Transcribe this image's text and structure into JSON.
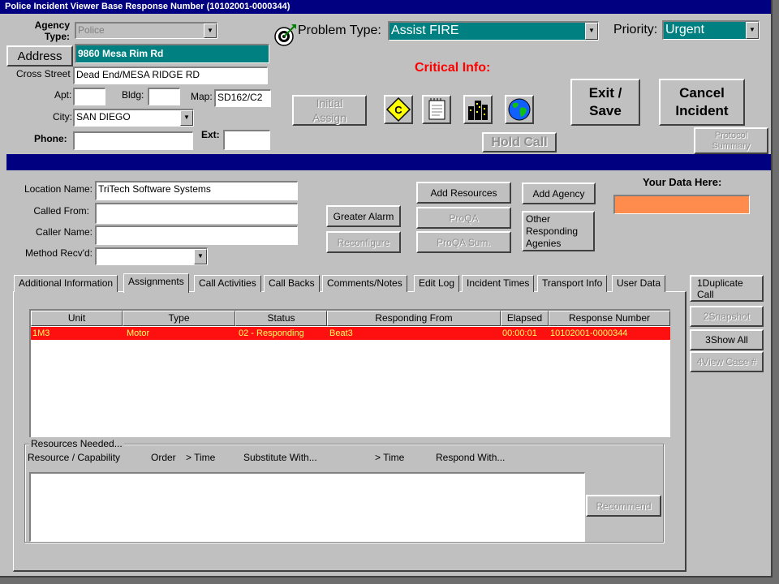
{
  "window": {
    "title": "Police Incident Viewer Base Response Number (10102001-0000344)"
  },
  "header": {
    "agency_type_label": "Agency Type:",
    "agency_type_value": "Police",
    "address_button": "Address",
    "address_value": "9860 Mesa Rim Rd",
    "cross_street_label": "Cross Street",
    "cross_street_value": "Dead End/MESA RIDGE RD",
    "apt_label": "Apt:",
    "apt_value": "",
    "bldg_label": "Bldg:",
    "bldg_value": "",
    "map_label": "Map:",
    "map_value": "SD162/C2",
    "city_label": "City:",
    "city_value": "SAN DIEGO",
    "phone_label": "Phone:",
    "phone_value": "",
    "ext_label": "Ext:",
    "ext_value": "",
    "problem_type_label": "Problem Type:",
    "problem_type_value": "Assist FIRE",
    "priority_label": "Priority:",
    "priority_value": "Urgent",
    "critical_info_label": "Critical Info:",
    "initial_assign_line1": "Initial",
    "initial_assign_line2": "Assign",
    "exit_save_line1": "Exit /",
    "exit_save_line2": "Save",
    "cancel_incident_line1": "Cancel",
    "cancel_incident_line2": "Incident",
    "hold_call": "Hold Call",
    "protocol_summary_line1": "Protocol",
    "protocol_summary_line2": "Summary"
  },
  "details": {
    "location_name_label": "Location Name:",
    "location_name_value": "TriTech Software Systems",
    "called_from_label": "Called From:",
    "called_from_value": "",
    "caller_name_label": "Caller Name:",
    "caller_name_value": "",
    "method_recvd_label": "Method Recv'd:",
    "method_recvd_value": "",
    "greater_alarm": "Greater Alarm",
    "reconfigure": "Reconfigure",
    "add_resources": "Add Resources",
    "proqa": "ProQA",
    "proqa_sum": "ProQA Sum.",
    "add_agency": "Add Agency",
    "other_responding_line1": "Other",
    "other_responding_line2": "Responding",
    "other_responding_line3": "Agenies",
    "your_data_label": "Your Data Here:",
    "your_data_value": "",
    "your_data_color": "#ff8c4c"
  },
  "tabs": [
    {
      "label": "Additional Information"
    },
    {
      "label": "Assignments"
    },
    {
      "label": "Call Activities"
    },
    {
      "label": "Call Backs"
    },
    {
      "label": "Comments/Notes"
    },
    {
      "label": "Edit Log"
    },
    {
      "label": "Incident Times"
    },
    {
      "label": "Transport Info"
    },
    {
      "label": "User Data"
    }
  ],
  "assignments": {
    "columns": [
      "Unit",
      "Type",
      "Status",
      "Responding From",
      "Elapsed",
      "Response Number"
    ],
    "rows": [
      {
        "unit": "1M3",
        "type": "Motor",
        "status": "02 - Responding",
        "responding_from": "Beat3",
        "elapsed": "00:00:01",
        "response_number": "10102001-0000344"
      }
    ],
    "row_color": "#ff1010",
    "row_text_color": "#ffff60"
  },
  "resources_needed": {
    "title": "Resources Needed...",
    "col_resource": "Resource / Capability",
    "col_order": "Order",
    "col_time1": "> Time",
    "col_substitute": "Substitute With...",
    "col_time2": "> Time",
    "col_respond": "Respond With...",
    "recommend": "Recommend"
  },
  "side_buttons": {
    "duplicate_line1": "1Duplicate",
    "duplicate_line2": "Call",
    "snapshot": "2Snapshot",
    "show_all": "3Show All",
    "view_case": "4View Case #"
  },
  "icons": {
    "problem_type_icon": "target-dart-icon",
    "caution_icon": "caution-c-diamond-icon",
    "notes_icon": "notepad-icon",
    "buildings_icon": "buildings-icon",
    "globe_icon": "globe-icon"
  },
  "colors": {
    "titlebar": "#000080",
    "address_bg": "#008080",
    "problem_bg": "#008080",
    "critical_info": "#ff0000"
  }
}
